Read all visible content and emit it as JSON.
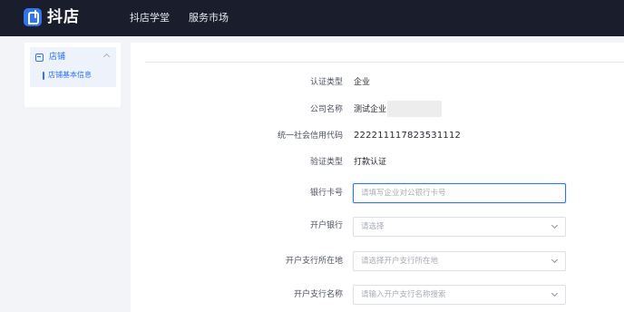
{
  "header": {
    "logo_text": "抖店",
    "nav": [
      "抖店学堂",
      "服务市场"
    ]
  },
  "sidebar": {
    "group_label": "店铺",
    "items": [
      {
        "label": "店铺基本信息",
        "active": true
      }
    ]
  },
  "form": {
    "fields": [
      {
        "label": "认证类型",
        "value": "企业"
      },
      {
        "label": "公司名称",
        "value": "测试企业"
      },
      {
        "label": "统一社会信用代码",
        "value": "222211117823531112"
      },
      {
        "label": "验证类型",
        "value": "打款认证"
      },
      {
        "label": "银行卡号",
        "placeholder": "请填写企业对公银行卡号"
      },
      {
        "label": "开户银行",
        "placeholder": "请选择"
      },
      {
        "label": "开户支行所在地",
        "placeholder": "请选择开户支行所在地"
      },
      {
        "label": "开户支行名称",
        "placeholder": "请输入开户支行名称搜索"
      }
    ]
  },
  "colors": {
    "brand": "#2f74f0",
    "topbar": "#1a1d2b",
    "page_background": "#f3f4f7"
  },
  "icons": [
    "logo-icon",
    "store-icon",
    "chevron-up-icon",
    "chevron-down-icon"
  ]
}
